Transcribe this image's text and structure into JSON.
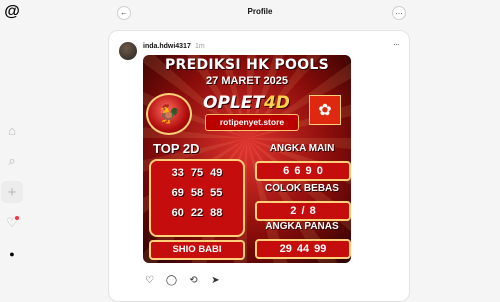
{
  "sidebar": {
    "logo_glyph": "@",
    "nav": {
      "home_glyph": "⌂",
      "search_glyph": "⌕",
      "create_glyph": "+",
      "activity_glyph": "♡",
      "profile_glyph": "●"
    }
  },
  "header": {
    "title": "Profile",
    "back_glyph": "←",
    "more_glyph": "…"
  },
  "post": {
    "username": "inda.hdwi4317",
    "time_ago": "1m",
    "more_glyph": "···",
    "image": {
      "title": "PREDIKSI HK POOLS",
      "date": "27 MARET 2025",
      "brand": "OPLET",
      "brand_suffix": "4D",
      "store": "rotipenyet.store",
      "top2d_label": "TOP 2D",
      "top2d_rows": [
        "33 75 49",
        "69 58 55",
        "60 22 88"
      ],
      "shio_label": "SHIO BABI",
      "angka_main_label": "ANGKA MAIN",
      "angka_main_value": "6 6 9 0",
      "colok_bebas_label": "COLOK BEBAS",
      "colok_bebas_value": "2 / 8",
      "angka_panas_label": "ANGKA PANAS",
      "angka_panas_value": "29 44 99",
      "rooster_glyph": "🐓",
      "flag_glyph": "✿"
    },
    "actions": {
      "like_glyph": "♡",
      "comment_glyph": "◯",
      "repost_glyph": "⟲",
      "share_glyph": "➤"
    }
  },
  "colors": {
    "background": "#f5f5f5",
    "card": "#ffffff",
    "poster_red": "#c60d0d",
    "poster_gold": "#ffcf7a",
    "notification": "#ff3040"
  }
}
